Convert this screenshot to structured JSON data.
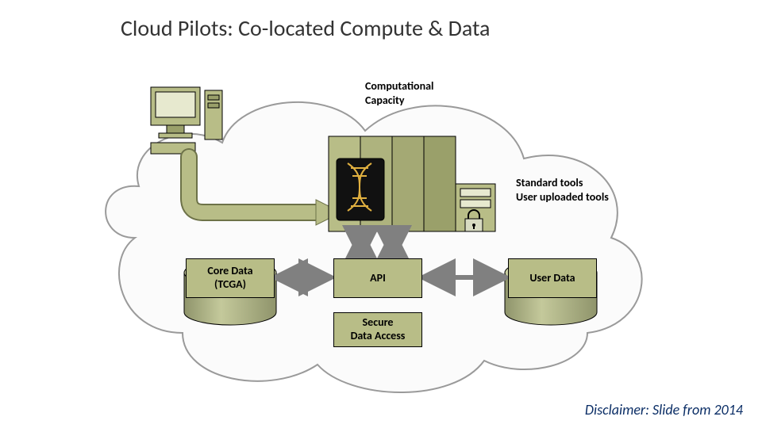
{
  "title": "Cloud Pilots: Co-located Compute & Data",
  "disclaimer": "Disclaimer: Slide from 2014",
  "labels": {
    "computational_capacity": "Computational\nCapacity",
    "standard_tools_line1": "Standard tools",
    "standard_tools_line2": "User uploaded tools"
  },
  "boxes": {
    "core_data_line1": "Core Data",
    "core_data_line2": "(TCGA)",
    "api": "API",
    "user_data": "User Data",
    "secure_line1": "Secure",
    "secure_line2": "Data Access"
  },
  "icons": {
    "desktop": "desktop-computer-icon",
    "servers": "server-rack-icon",
    "dna": "dna-helix-icon",
    "lock": "padlock-icon",
    "cloud": "cloud-outline-icon",
    "cylinder_left": "database-cylinder-icon",
    "cylinder_right": "database-cylinder-icon"
  },
  "colors": {
    "olive": "#b8bd87",
    "olive_dark": "#9aa06a",
    "cloud_stroke": "#9a9a9a",
    "arrow": "#808080",
    "title": "#333333",
    "disclaimer": "#0b2e66"
  }
}
